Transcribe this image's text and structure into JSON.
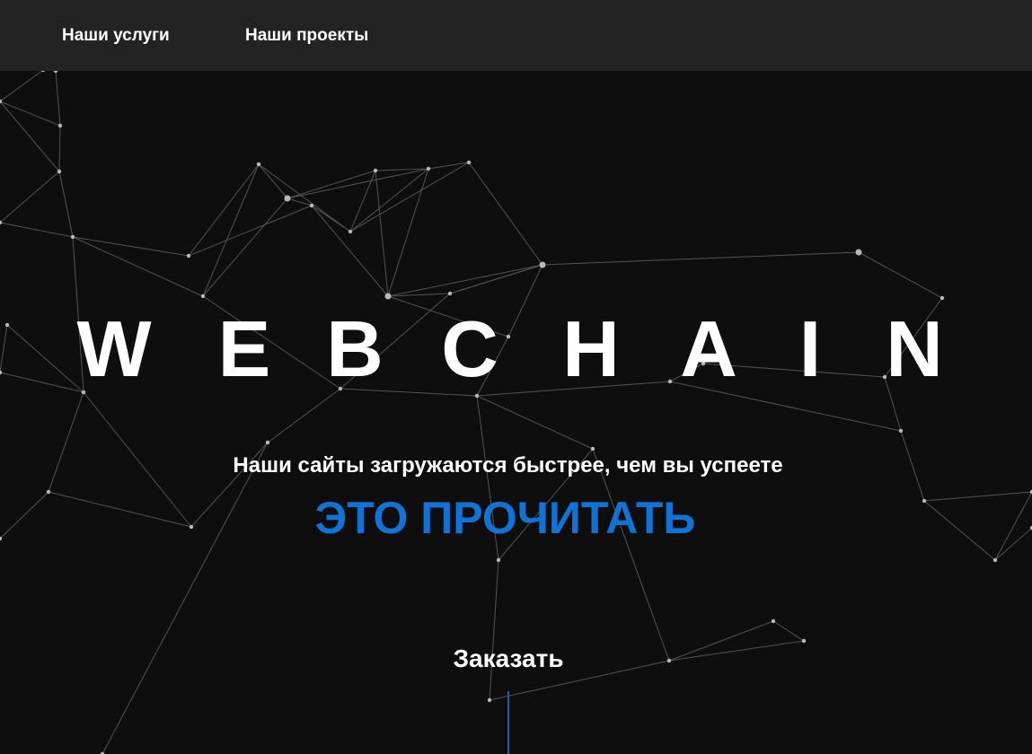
{
  "nav": {
    "items": [
      {
        "label": "Наши услуги"
      },
      {
        "label": "Наши проекты"
      }
    ]
  },
  "hero": {
    "brand_letters": [
      "W",
      "E",
      "B",
      "C",
      "H",
      "A",
      "I",
      "N"
    ],
    "tagline": "Наши сайты загружаются быстрее, чем вы успеете",
    "highlight": "ЭТО ПРОЧИТАТЬ",
    "order_label": "Заказать"
  },
  "colors": {
    "background": "#0e0e0f",
    "navbar": "#232324",
    "accent": "#1273d6",
    "text": "#ffffff"
  }
}
